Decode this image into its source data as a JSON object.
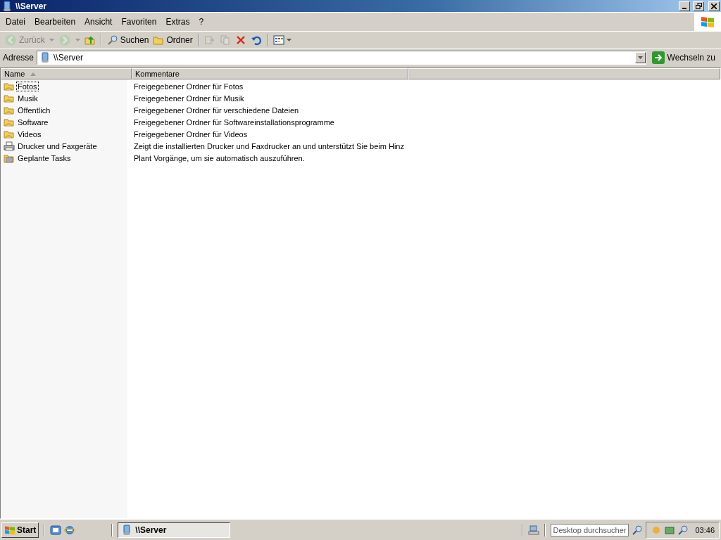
{
  "window": {
    "title": "\\\\Server"
  },
  "menu": [
    "Datei",
    "Bearbeiten",
    "Ansicht",
    "Favoriten",
    "Extras",
    "?"
  ],
  "toolbar": [
    {
      "kind": "back",
      "label": "Zurück",
      "disabled": true
    },
    {
      "kind": "forward",
      "disabled": true
    },
    {
      "kind": "up",
      "disabled": false
    },
    {
      "kind": "separator"
    },
    {
      "kind": "search",
      "label": "Suchen",
      "disabled": false
    },
    {
      "kind": "folder",
      "label": "Ordner",
      "disabled": false
    },
    {
      "kind": "separator"
    },
    {
      "kind": "move",
      "disabled": true
    },
    {
      "kind": "copy",
      "disabled": true
    },
    {
      "kind": "delete",
      "disabled": false
    },
    {
      "kind": "undo",
      "disabled": false
    },
    {
      "kind": "separator"
    },
    {
      "kind": "views",
      "disabled": false
    }
  ],
  "address": {
    "label": "Adresse",
    "value": "\\\\Server",
    "go": "Wechseln zu"
  },
  "table": {
    "columns": [
      {
        "label": "Name",
        "sorted": true
      },
      {
        "label": "Kommentare",
        "sorted": false
      }
    ],
    "rows": [
      {
        "name": "Fotos",
        "comment": "Freigegebener Ordner für Fotos",
        "kind": "share",
        "focused": true
      },
      {
        "name": "Musik",
        "comment": "Freigegebener Ordner für Musik",
        "kind": "share",
        "focused": false
      },
      {
        "name": "Öffentlich",
        "comment": "Freigegebener Ordner für verschiedene Dateien",
        "kind": "share",
        "focused": false
      },
      {
        "name": "Software",
        "comment": "Freigegebener Ordner für Softwareinstallationsprogramme",
        "kind": "share",
        "focused": false
      },
      {
        "name": "Videos",
        "comment": "Freigegebener Ordner für Videos",
        "kind": "share",
        "focused": false
      },
      {
        "name": "Drucker und Faxgeräte",
        "comment": "Zeigt die installierten Drucker und Faxdrucker an und unterstützt Sie beim Hinz",
        "kind": "printers",
        "focused": false
      },
      {
        "name": "Geplante Tasks",
        "comment": "Plant Vorgänge, um sie automatisch auszuführen.",
        "kind": "tasks",
        "focused": false
      }
    ]
  },
  "taskbar": {
    "start": "Start",
    "tasks": [
      {
        "label": "\\\\Server",
        "selected": true
      }
    ],
    "search": {
      "placeholder": "Desktop durchsucher"
    },
    "clock": "03:46"
  }
}
